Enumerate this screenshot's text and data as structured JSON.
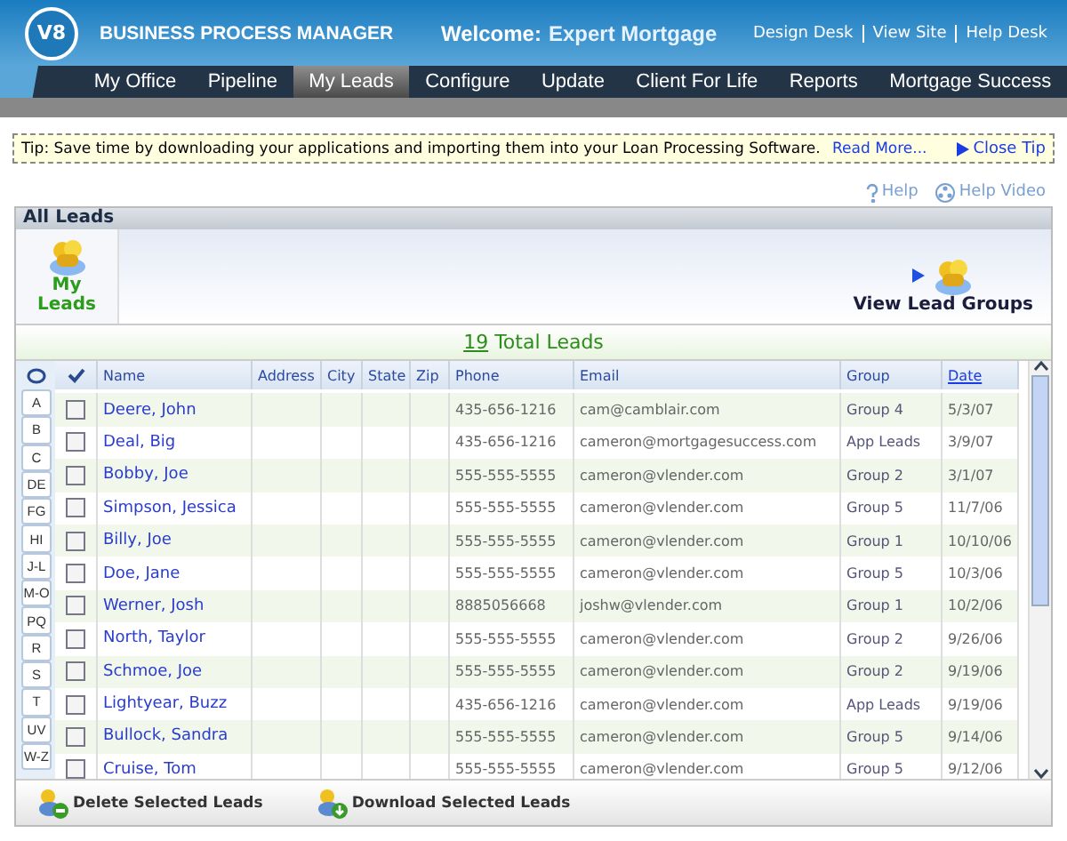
{
  "header": {
    "logo": "V8",
    "title": "BUSINESS PROCESS MANAGER",
    "welcome_label": "Welcome:",
    "welcome_name": "Expert Mortgage",
    "links": [
      "Design Desk",
      "View Site",
      "Help Desk"
    ]
  },
  "nav": [
    {
      "label": "My Office",
      "selected": false
    },
    {
      "label": "Pipeline",
      "selected": false
    },
    {
      "label": "My Leads",
      "selected": true
    },
    {
      "label": "Configure",
      "selected": false
    },
    {
      "label": "Update",
      "selected": false
    },
    {
      "label": "Client For Life",
      "selected": false
    },
    {
      "label": "Reports",
      "selected": false
    },
    {
      "label": "Mortgage Success",
      "selected": false
    }
  ],
  "tip": {
    "text": "Tip: Save time by downloading your applications and importing them into your Loan Processing Software.",
    "link": "Read More...",
    "close": "Close Tip"
  },
  "help_links": [
    {
      "kind": "help",
      "label": "Help"
    },
    {
      "kind": "video",
      "label": "Help Video"
    }
  ],
  "panel": {
    "title": "All Leads",
    "views": [
      {
        "label": "My Leads",
        "selected": true
      },
      {
        "label": "View Lead Groups",
        "selected": false
      }
    ],
    "total_count": "19",
    "total_label": "Total Leads",
    "letters": [
      "A",
      "B",
      "C",
      "DE",
      "FG",
      "HI",
      "J-L",
      "M-O",
      "PQ",
      "R",
      "S",
      "T",
      "UV",
      "W-Z"
    ],
    "columns": [
      {
        "label": "Name",
        "sorted": false
      },
      {
        "label": "Address",
        "sorted": false
      },
      {
        "label": "City",
        "sorted": false
      },
      {
        "label": "State",
        "sorted": false
      },
      {
        "label": "Zip",
        "sorted": false
      },
      {
        "label": "Phone",
        "sorted": false
      },
      {
        "label": "Email",
        "sorted": false
      },
      {
        "label": "Group",
        "sorted": false
      },
      {
        "label": "Date",
        "sorted": true
      }
    ],
    "rows": [
      {
        "checked": false,
        "cells": [
          "Deere, John",
          "",
          "",
          "",
          "",
          "435-656-1216",
          "cam@camblair.com",
          "Group 4",
          "5/3/07"
        ]
      },
      {
        "checked": false,
        "cells": [
          "Deal, Big",
          "",
          "",
          "",
          "",
          "435-656-1216",
          "cameron@mortgagesuccess.com",
          "App Leads",
          "3/9/07"
        ]
      },
      {
        "checked": false,
        "cells": [
          "Bobby, Joe",
          "",
          "",
          "",
          "",
          "555-555-5555",
          "cameron@vlender.com",
          "Group 2",
          "3/1/07"
        ]
      },
      {
        "checked": false,
        "cells": [
          "Simpson, Jessica",
          "",
          "",
          "",
          "",
          "555-555-5555",
          "cameron@vlender.com",
          "Group 5",
          "11/7/06"
        ]
      },
      {
        "checked": false,
        "cells": [
          "Billy, Joe",
          "",
          "",
          "",
          "",
          "555-555-5555",
          "cameron@vlender.com",
          "Group 1",
          "10/10/06"
        ]
      },
      {
        "checked": false,
        "cells": [
          "Doe, Jane",
          "",
          "",
          "",
          "",
          "555-555-5555",
          "cameron@vlender.com",
          "Group 5",
          "10/3/06"
        ]
      },
      {
        "checked": false,
        "cells": [
          "Werner, Josh",
          "",
          "",
          "",
          "",
          "8885056668",
          "joshw@vlender.com",
          "Group 1",
          "10/2/06"
        ]
      },
      {
        "checked": false,
        "cells": [
          "North, Taylor",
          "",
          "",
          "",
          "",
          "555-555-5555",
          "cameron@vlender.com",
          "Group 2",
          "9/26/06"
        ]
      },
      {
        "checked": false,
        "cells": [
          "Schmoe, Joe",
          "",
          "",
          "",
          "",
          "555-555-5555",
          "cameron@vlender.com",
          "Group 2",
          "9/19/06"
        ]
      },
      {
        "checked": false,
        "cells": [
          "Lightyear, Buzz",
          "",
          "",
          "",
          "",
          "435-656-1216",
          "cameron@vlender.com",
          "App Leads",
          "9/19/06"
        ]
      },
      {
        "checked": false,
        "cells": [
          "Bullock, Sandra",
          "",
          "",
          "",
          "",
          "555-555-5555",
          "cameron@vlender.com",
          "Group 5",
          "9/14/06"
        ]
      },
      {
        "checked": false,
        "cells": [
          "Cruise, Tom",
          "",
          "",
          "",
          "",
          "555-555-5555",
          "cameron@vlender.com",
          "Group 5",
          "9/12/06"
        ]
      }
    ],
    "actions": [
      {
        "kind": "delete",
        "label": "Delete Selected Leads"
      },
      {
        "kind": "download",
        "label": "Download Selected Leads"
      }
    ]
  }
}
